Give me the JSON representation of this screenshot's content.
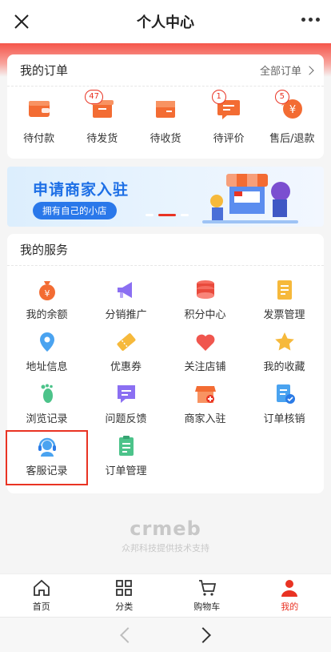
{
  "header": {
    "title": "个人中心"
  },
  "orders": {
    "heading": "我的订单",
    "all_label": "全部订单",
    "items": [
      {
        "label": "待付款",
        "icon": "wallet-icon",
        "badge": ""
      },
      {
        "label": "待发货",
        "icon": "box-icon",
        "badge": "47"
      },
      {
        "label": "待收货",
        "icon": "package-icon",
        "badge": ""
      },
      {
        "label": "待评价",
        "icon": "comment-icon",
        "badge": "1"
      },
      {
        "label": "售后/退款",
        "icon": "refund-icon",
        "badge": "5"
      }
    ]
  },
  "banner": {
    "title": "申请商家入驻",
    "subtitle": "拥有自己的小店"
  },
  "services": {
    "heading": "我的服务",
    "items": [
      {
        "label": "我的余额",
        "icon": "money-bag-icon"
      },
      {
        "label": "分销推广",
        "icon": "megaphone-icon"
      },
      {
        "label": "积分中心",
        "icon": "coins-icon"
      },
      {
        "label": "发票管理",
        "icon": "invoice-icon"
      },
      {
        "label": "地址信息",
        "icon": "location-pin-icon"
      },
      {
        "label": "优惠券",
        "icon": "coupon-icon"
      },
      {
        "label": "关注店铺",
        "icon": "heart-icon"
      },
      {
        "label": "我的收藏",
        "icon": "star-icon"
      },
      {
        "label": "浏览记录",
        "icon": "footprint-icon"
      },
      {
        "label": "问题反馈",
        "icon": "feedback-icon"
      },
      {
        "label": "商家入驻",
        "icon": "store-icon"
      },
      {
        "label": "订单核销",
        "icon": "verify-icon"
      },
      {
        "label": "客服记录",
        "icon": "headset-icon"
      },
      {
        "label": "订单管理",
        "icon": "clipboard-icon"
      }
    ]
  },
  "footer_brand": {
    "logo": "crmeb",
    "text": "众邦科技提供技术支持"
  },
  "tabbar": {
    "items": [
      {
        "label": "首页",
        "icon": "home-icon"
      },
      {
        "label": "分类",
        "icon": "grid-icon"
      },
      {
        "label": "购物车",
        "icon": "cart-icon"
      },
      {
        "label": "我的",
        "icon": "user-icon"
      }
    ],
    "active_index": 3
  },
  "colors": {
    "accent": "#e93323",
    "banner_blue": "#1d6fe6",
    "orange": "#f36c33"
  }
}
